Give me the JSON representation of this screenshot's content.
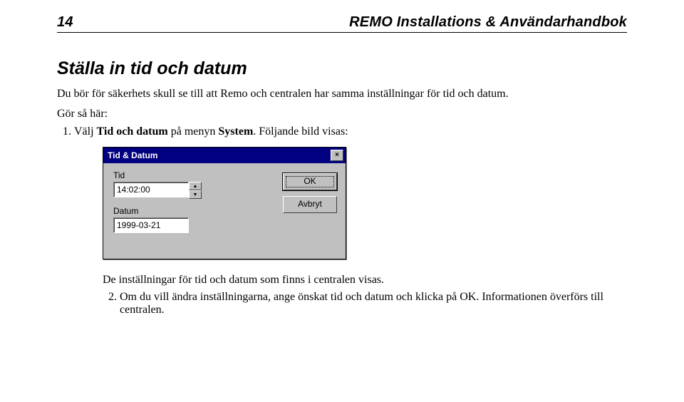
{
  "header": {
    "page_number": "14",
    "running_title": "REMO Installations & Användarhandbok"
  },
  "section": {
    "title": "Ställa in tid och datum",
    "intro": "Du bör för säkerhets skull se till att Remo och centralen har samma inställningar för tid och datum.",
    "how_to": "Gör så här:"
  },
  "steps_1": {
    "item_prefix": "Välj ",
    "item_bold": "Tid och datum",
    "item_mid": " på menyn ",
    "item_bold2": "System",
    "item_suffix": ". Följande bild visas:"
  },
  "dialog": {
    "title": "Tid & Datum",
    "close_glyph": "×",
    "time_label": "Tid",
    "time_value": "14:02:00",
    "spin_up": "▲",
    "spin_down": "▼",
    "date_label": "Datum",
    "date_value": "1999-03-21",
    "ok_label": "OK",
    "cancel_label": "Avbryt"
  },
  "after": {
    "caption": "De inställningar för tid och datum som finns i centralen visas.",
    "step2": "Om du vill ändra inställningarna, ange önskat tid och datum och klicka på OK. Informationen överförs till centralen."
  }
}
